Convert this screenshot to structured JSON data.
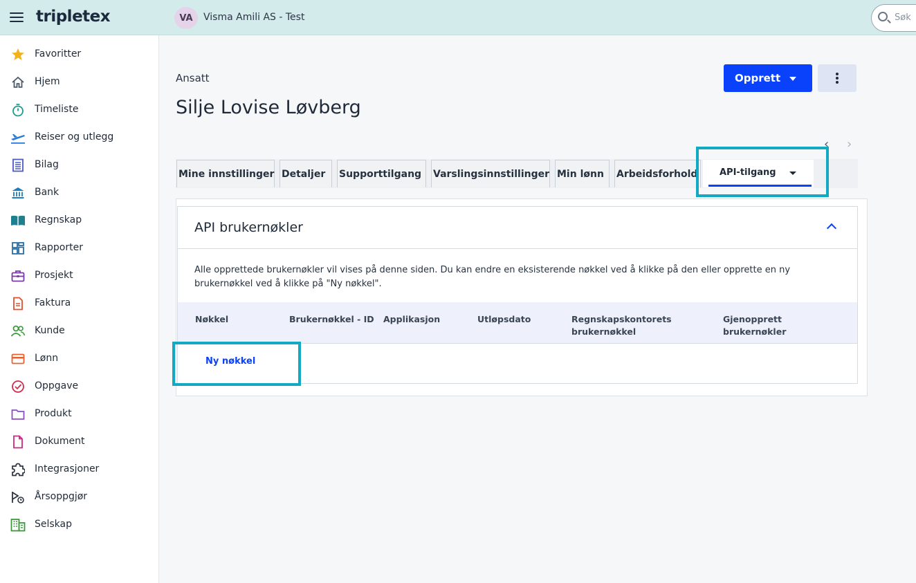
{
  "app": {
    "logo": "tripletex",
    "avatar_initials": "VA",
    "company": "Visma Amili AS - Test",
    "search_placeholder": "Søk"
  },
  "sidebar": {
    "items": [
      {
        "label": "Favoritter",
        "icon": "star-icon"
      },
      {
        "label": "Hjem",
        "icon": "home-icon"
      },
      {
        "label": "Timeliste",
        "icon": "stopwatch-icon"
      },
      {
        "label": "Reiser og utlegg",
        "icon": "plane-icon"
      },
      {
        "label": "Bilag",
        "icon": "document-lines-icon"
      },
      {
        "label": "Bank",
        "icon": "bank-icon"
      },
      {
        "label": "Regnskap",
        "icon": "book-icon"
      },
      {
        "label": "Rapporter",
        "icon": "dashboard-icon"
      },
      {
        "label": "Prosjekt",
        "icon": "briefcase-icon"
      },
      {
        "label": "Faktura",
        "icon": "invoice-icon"
      },
      {
        "label": "Kunde",
        "icon": "people-icon"
      },
      {
        "label": "Lønn",
        "icon": "card-icon"
      },
      {
        "label": "Oppgave",
        "icon": "check-circle-icon"
      },
      {
        "label": "Produkt",
        "icon": "folder-icon"
      },
      {
        "label": "Dokument",
        "icon": "file-icon"
      },
      {
        "label": "Integrasjoner",
        "icon": "puzzle-icon"
      },
      {
        "label": "Årsoppgjør",
        "icon": "year-end-icon"
      },
      {
        "label": "Selskap",
        "icon": "building-icon"
      }
    ]
  },
  "page": {
    "breadcrumb": "Ansatt",
    "title": "Silje Lovise Løvberg",
    "create_label": "Opprett"
  },
  "tabs": [
    {
      "label": "Mine innstillinger"
    },
    {
      "label": "Detaljer"
    },
    {
      "label": "Supporttilgang"
    },
    {
      "label": "Varslingsinnstillinger"
    },
    {
      "label": "Min lønn"
    },
    {
      "label": "Arbeidsforhold"
    }
  ],
  "active_tab": {
    "label": "API-tilgang"
  },
  "section": {
    "title": "API brukernøkler",
    "description": "Alle opprettede brukernøkler vil vises på denne siden. Du kan endre en eksisterende nøkkel ved å klikke på den eller opprette en ny brukernøkkel ved å klikke på \"Ny nøkkel\".",
    "columns": [
      {
        "line1": "",
        "line2": "Nøkkel"
      },
      {
        "line1": "",
        "line2": "Brukernøkkel - ID"
      },
      {
        "line1": "",
        "line2": "Applikasjon"
      },
      {
        "line1": "",
        "line2": "Utløpsdato"
      },
      {
        "line1": "Regnskapskontorets",
        "line2": "brukernøkkel"
      },
      {
        "line1": "Gjenopprett",
        "line2": "brukernøkler"
      }
    ],
    "new_key_label": "Ny nøkkel"
  },
  "colors": {
    "accent": "#0a41fa",
    "highlight": "#13a9c3",
    "topbar": "#d3ebea"
  }
}
